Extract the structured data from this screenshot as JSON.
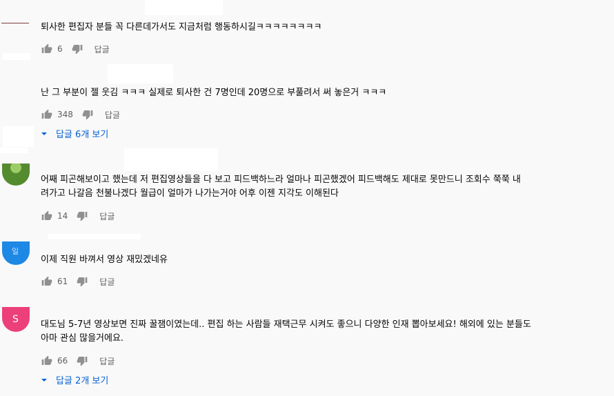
{
  "comments": [
    {
      "text_lines": [
        "퇴사한 편집자 분들 꼭 다른데가서도 지금처럼 행동하시길ㅋㅋㅋㅋㅋㅋㅋㅋ"
      ],
      "likes": "6",
      "reply_label": "답글"
    },
    {
      "text_lines": [
        "난 그 부분이 젤 웃김 ㅋㅋㅋ 실제로 퇴사한 건 7명인데 20명으로 부풀려서 써 놓은거 ㅋㅋㅋ"
      ],
      "likes": "348",
      "reply_label": "답글",
      "view_replies": "답글 6개 보기"
    },
    {
      "text_lines": [
        "어째 피곤해보이고 했는데 저 편집영상들을 다 보고 피드백하느라 얼마나 피곤했겠어 피드백해도 제대로 못만드니 조회수 쭉쭉 내",
        "려가고 나갈음 천불나겠다 월급이 얼마가 나가는거야 어후 이젠 지각도 이해된다"
      ],
      "likes": "14",
      "reply_label": "답글"
    },
    {
      "avatar_letter": "일",
      "text_lines": [
        "이제 직원 바껴서 영상 재밌겠네유"
      ],
      "likes": "61",
      "reply_label": "답글"
    },
    {
      "avatar_letter": "S",
      "text_lines": [
        "대도님 5-7년 영상보면 진짜 꿀잼이였는데.. 편집 하는 사람들 재택근무 시켜도 좋으니 다양한 인재 뽑아보세요! 해외에 있는 분들도",
        "아마 관심 많을거에요."
      ],
      "likes": "66",
      "reply_label": "답글",
      "view_replies": "답글 2개 보기"
    }
  ],
  "colors": {
    "blue_link": "#065fd4",
    "avatar_green": "#558b2f",
    "avatar_blue": "#1e88e5",
    "avatar_pink": "#ec407a"
  }
}
